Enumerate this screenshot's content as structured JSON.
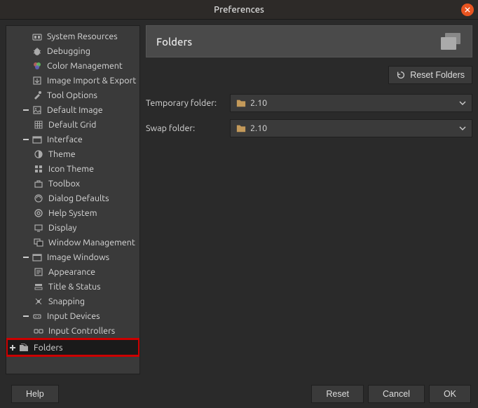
{
  "window": {
    "title": "Preferences"
  },
  "sidebar": {
    "items": [
      {
        "label": "System Resources",
        "level": 1,
        "icon": "resources"
      },
      {
        "label": "Debugging",
        "level": 1,
        "icon": "debug"
      },
      {
        "label": "Color Management",
        "level": 1,
        "icon": "color"
      },
      {
        "label": "Image Import & Export",
        "level": 1,
        "icon": "import"
      },
      {
        "label": "Tool Options",
        "level": 1,
        "icon": "tool"
      },
      {
        "label": "Default Image",
        "level": 1,
        "icon": "image",
        "expander": "-"
      },
      {
        "label": "Default Grid",
        "level": 2,
        "icon": "grid"
      },
      {
        "label": "Interface",
        "level": 1,
        "icon": "interface",
        "expander": "-"
      },
      {
        "label": "Theme",
        "level": 2,
        "icon": "theme"
      },
      {
        "label": "Icon Theme",
        "level": 2,
        "icon": "icontheme"
      },
      {
        "label": "Toolbox",
        "level": 2,
        "icon": "toolbox"
      },
      {
        "label": "Dialog Defaults",
        "level": 2,
        "icon": "dialog"
      },
      {
        "label": "Help System",
        "level": 2,
        "icon": "help"
      },
      {
        "label": "Display",
        "level": 2,
        "icon": "display"
      },
      {
        "label": "Window Management",
        "level": 2,
        "icon": "window"
      },
      {
        "label": "Image Windows",
        "level": 1,
        "icon": "imgwin",
        "expander": "-"
      },
      {
        "label": "Appearance",
        "level": 2,
        "icon": "appearance"
      },
      {
        "label": "Title & Status",
        "level": 2,
        "icon": "title"
      },
      {
        "label": "Snapping",
        "level": 2,
        "icon": "snapping"
      },
      {
        "label": "Input Devices",
        "level": 1,
        "icon": "input",
        "expander": "-"
      },
      {
        "label": "Input Controllers",
        "level": 2,
        "icon": "controllers"
      },
      {
        "label": "Folders",
        "level": 1,
        "icon": "folders",
        "expander": "+",
        "selected": true,
        "highlighted": true
      }
    ]
  },
  "panel": {
    "title": "Folders",
    "reset_label": "Reset Folders",
    "temp_label": "Temporary folder:",
    "temp_value": "2.10",
    "swap_label": "Swap folder:",
    "swap_value": "2.10"
  },
  "footer": {
    "help": "Help",
    "reset": "Reset",
    "cancel": "Cancel",
    "ok": "OK"
  }
}
